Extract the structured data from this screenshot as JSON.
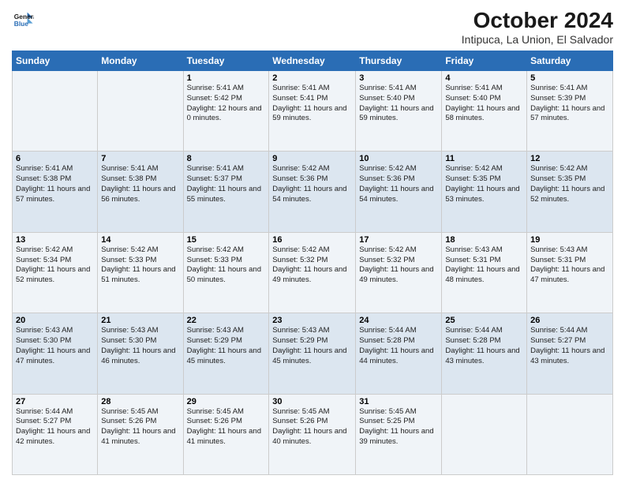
{
  "logo": {
    "line1": "General",
    "line2": "Blue"
  },
  "title": "October 2024",
  "subtitle": "Intipuca, La Union, El Salvador",
  "days_of_week": [
    "Sunday",
    "Monday",
    "Tuesday",
    "Wednesday",
    "Thursday",
    "Friday",
    "Saturday"
  ],
  "weeks": [
    [
      {
        "day": "",
        "sunrise": "",
        "sunset": "",
        "daylight": ""
      },
      {
        "day": "",
        "sunrise": "",
        "sunset": "",
        "daylight": ""
      },
      {
        "day": "1",
        "sunrise": "Sunrise: 5:41 AM",
        "sunset": "Sunset: 5:42 PM",
        "daylight": "Daylight: 12 hours and 0 minutes."
      },
      {
        "day": "2",
        "sunrise": "Sunrise: 5:41 AM",
        "sunset": "Sunset: 5:41 PM",
        "daylight": "Daylight: 11 hours and 59 minutes."
      },
      {
        "day": "3",
        "sunrise": "Sunrise: 5:41 AM",
        "sunset": "Sunset: 5:40 PM",
        "daylight": "Daylight: 11 hours and 59 minutes."
      },
      {
        "day": "4",
        "sunrise": "Sunrise: 5:41 AM",
        "sunset": "Sunset: 5:40 PM",
        "daylight": "Daylight: 11 hours and 58 minutes."
      },
      {
        "day": "5",
        "sunrise": "Sunrise: 5:41 AM",
        "sunset": "Sunset: 5:39 PM",
        "daylight": "Daylight: 11 hours and 57 minutes."
      }
    ],
    [
      {
        "day": "6",
        "sunrise": "Sunrise: 5:41 AM",
        "sunset": "Sunset: 5:38 PM",
        "daylight": "Daylight: 11 hours and 57 minutes."
      },
      {
        "day": "7",
        "sunrise": "Sunrise: 5:41 AM",
        "sunset": "Sunset: 5:38 PM",
        "daylight": "Daylight: 11 hours and 56 minutes."
      },
      {
        "day": "8",
        "sunrise": "Sunrise: 5:41 AM",
        "sunset": "Sunset: 5:37 PM",
        "daylight": "Daylight: 11 hours and 55 minutes."
      },
      {
        "day": "9",
        "sunrise": "Sunrise: 5:42 AM",
        "sunset": "Sunset: 5:36 PM",
        "daylight": "Daylight: 11 hours and 54 minutes."
      },
      {
        "day": "10",
        "sunrise": "Sunrise: 5:42 AM",
        "sunset": "Sunset: 5:36 PM",
        "daylight": "Daylight: 11 hours and 54 minutes."
      },
      {
        "day": "11",
        "sunrise": "Sunrise: 5:42 AM",
        "sunset": "Sunset: 5:35 PM",
        "daylight": "Daylight: 11 hours and 53 minutes."
      },
      {
        "day": "12",
        "sunrise": "Sunrise: 5:42 AM",
        "sunset": "Sunset: 5:35 PM",
        "daylight": "Daylight: 11 hours and 52 minutes."
      }
    ],
    [
      {
        "day": "13",
        "sunrise": "Sunrise: 5:42 AM",
        "sunset": "Sunset: 5:34 PM",
        "daylight": "Daylight: 11 hours and 52 minutes."
      },
      {
        "day": "14",
        "sunrise": "Sunrise: 5:42 AM",
        "sunset": "Sunset: 5:33 PM",
        "daylight": "Daylight: 11 hours and 51 minutes."
      },
      {
        "day": "15",
        "sunrise": "Sunrise: 5:42 AM",
        "sunset": "Sunset: 5:33 PM",
        "daylight": "Daylight: 11 hours and 50 minutes."
      },
      {
        "day": "16",
        "sunrise": "Sunrise: 5:42 AM",
        "sunset": "Sunset: 5:32 PM",
        "daylight": "Daylight: 11 hours and 49 minutes."
      },
      {
        "day": "17",
        "sunrise": "Sunrise: 5:42 AM",
        "sunset": "Sunset: 5:32 PM",
        "daylight": "Daylight: 11 hours and 49 minutes."
      },
      {
        "day": "18",
        "sunrise": "Sunrise: 5:43 AM",
        "sunset": "Sunset: 5:31 PM",
        "daylight": "Daylight: 11 hours and 48 minutes."
      },
      {
        "day": "19",
        "sunrise": "Sunrise: 5:43 AM",
        "sunset": "Sunset: 5:31 PM",
        "daylight": "Daylight: 11 hours and 47 minutes."
      }
    ],
    [
      {
        "day": "20",
        "sunrise": "Sunrise: 5:43 AM",
        "sunset": "Sunset: 5:30 PM",
        "daylight": "Daylight: 11 hours and 47 minutes."
      },
      {
        "day": "21",
        "sunrise": "Sunrise: 5:43 AM",
        "sunset": "Sunset: 5:30 PM",
        "daylight": "Daylight: 11 hours and 46 minutes."
      },
      {
        "day": "22",
        "sunrise": "Sunrise: 5:43 AM",
        "sunset": "Sunset: 5:29 PM",
        "daylight": "Daylight: 11 hours and 45 minutes."
      },
      {
        "day": "23",
        "sunrise": "Sunrise: 5:43 AM",
        "sunset": "Sunset: 5:29 PM",
        "daylight": "Daylight: 11 hours and 45 minutes."
      },
      {
        "day": "24",
        "sunrise": "Sunrise: 5:44 AM",
        "sunset": "Sunset: 5:28 PM",
        "daylight": "Daylight: 11 hours and 44 minutes."
      },
      {
        "day": "25",
        "sunrise": "Sunrise: 5:44 AM",
        "sunset": "Sunset: 5:28 PM",
        "daylight": "Daylight: 11 hours and 43 minutes."
      },
      {
        "day": "26",
        "sunrise": "Sunrise: 5:44 AM",
        "sunset": "Sunset: 5:27 PM",
        "daylight": "Daylight: 11 hours and 43 minutes."
      }
    ],
    [
      {
        "day": "27",
        "sunrise": "Sunrise: 5:44 AM",
        "sunset": "Sunset: 5:27 PM",
        "daylight": "Daylight: 11 hours and 42 minutes."
      },
      {
        "day": "28",
        "sunrise": "Sunrise: 5:45 AM",
        "sunset": "Sunset: 5:26 PM",
        "daylight": "Daylight: 11 hours and 41 minutes."
      },
      {
        "day": "29",
        "sunrise": "Sunrise: 5:45 AM",
        "sunset": "Sunset: 5:26 PM",
        "daylight": "Daylight: 11 hours and 41 minutes."
      },
      {
        "day": "30",
        "sunrise": "Sunrise: 5:45 AM",
        "sunset": "Sunset: 5:26 PM",
        "daylight": "Daylight: 11 hours and 40 minutes."
      },
      {
        "day": "31",
        "sunrise": "Sunrise: 5:45 AM",
        "sunset": "Sunset: 5:25 PM",
        "daylight": "Daylight: 11 hours and 39 minutes."
      },
      {
        "day": "",
        "sunrise": "",
        "sunset": "",
        "daylight": ""
      },
      {
        "day": "",
        "sunrise": "",
        "sunset": "",
        "daylight": ""
      }
    ]
  ]
}
